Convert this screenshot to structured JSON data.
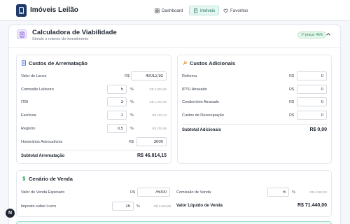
{
  "app": {
    "title": "Imóveis Leilão"
  },
  "nav": [
    {
      "label": "Dashboard",
      "icon": "grid-icon",
      "active": false
    },
    {
      "label": "Imóveis",
      "icon": "building-icon",
      "active": true
    },
    {
      "label": "Favoritos",
      "icon": "heart-icon",
      "active": false
    }
  ],
  "calculator": {
    "title": "Calculadora de Viabilidade",
    "subtitle": "Simule o retorno do investimento",
    "badge": "1ª praça: 45%",
    "icon": "calculator-icon",
    "collapse_icon": "chevron-up-icon"
  },
  "custos_arrematacao": {
    "title": "Custos de Arrematação",
    "icon": "file-text-icon",
    "fields": [
      {
        "label": "Valor do Lance",
        "prefix": "R$",
        "value": "40012,92",
        "suffix": "",
        "computed": ""
      },
      {
        "label": "Comissão Leiloeiro",
        "prefix": "",
        "value": "5",
        "suffix": "%",
        "computed": "R$ 2.000,65"
      },
      {
        "label": "ITBI",
        "prefix": "",
        "value": "3",
        "suffix": "%",
        "computed": "R$ 1.200,39"
      },
      {
        "label": "Escritura",
        "prefix": "",
        "value": "1",
        "suffix": "%",
        "computed": "R$ 400,13"
      },
      {
        "label": "Registro",
        "prefix": "",
        "value": "0,5",
        "suffix": "%",
        "computed": "R$ 200,06"
      },
      {
        "label": "Honorários Advocatícios",
        "prefix": "R$",
        "value": "3000",
        "suffix": "",
        "computed": ""
      }
    ],
    "subtotal_label": "Subtotal Arrematação",
    "subtotal_value": "R$ 46.814,15"
  },
  "custos_adicionais": {
    "title": "Custos Adicionais",
    "icon": "wrench-icon",
    "fields": [
      {
        "label": "Reforma",
        "prefix": "R$",
        "value": "0"
      },
      {
        "label": "IPTU Atrasado",
        "prefix": "R$",
        "value": "0"
      },
      {
        "label": "Condomínio Atrasado",
        "prefix": "R$",
        "value": "0"
      },
      {
        "label": "Custos de Desocupação",
        "prefix": "R$",
        "value": "0"
      }
    ],
    "subtotal_label": "Subtotal Adicionais",
    "subtotal_value": "R$ 0,00"
  },
  "cenario_venda": {
    "title": "Cenário de Venda",
    "icon": "dollar-icon",
    "valor_venda": {
      "label": "Valor de Venda Esperado",
      "prefix": "R$",
      "value": "76000"
    },
    "comissao_venda": {
      "label": "Comissão de Venda",
      "value": "6",
      "suffix": "%",
      "computed": "R$ 4.560,00"
    },
    "imposto_lucro": {
      "label": "Imposto sobre Lucro",
      "value": "15",
      "suffix": "%",
      "computed": "R$ 3.693,88"
    },
    "valor_liquido_label": "Valor Líquido de Venda",
    "valor_liquido_value": "R$ 71.440,00"
  },
  "fab": {
    "label": "N"
  },
  "colors": {
    "accent": "#1d6f5c",
    "brand": "#1f3b6b",
    "badge": "#1f8a4c"
  }
}
